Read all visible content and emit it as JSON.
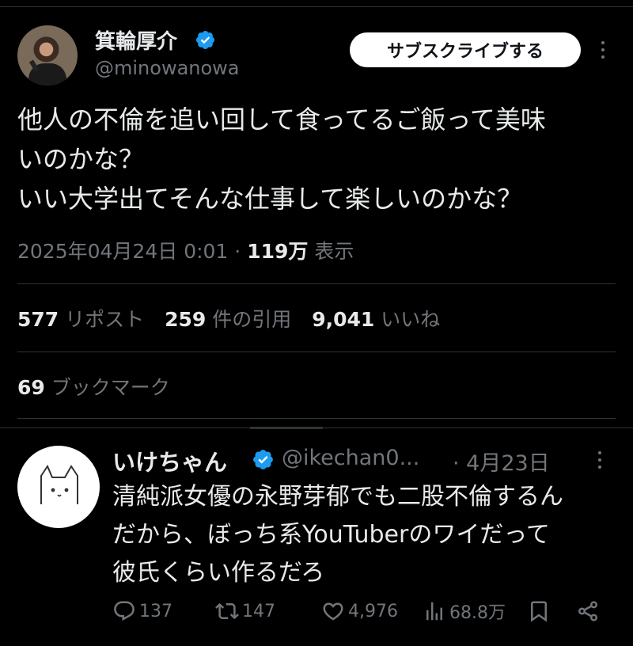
{
  "main_tweet": {
    "author_name": "箕輪厚介",
    "handle": "@minowanowa",
    "subscribe_label": "サブスクライブする",
    "text_lines": [
      "他人の不倫を追い回して食ってるご飯って美味",
      "いのかな？",
      "いい大学出てそんな仕事して楽しいのかな？"
    ],
    "timestamp": "2025年04月24日 0:01",
    "separator": "·",
    "views_count": "119万",
    "views_label": "表示",
    "stats": {
      "reposts_count": "577",
      "reposts_label": "リポスト",
      "quotes_count": "259",
      "quotes_label": "件の引用",
      "likes_count": "9,041",
      "likes_label": "いいね",
      "bookmarks_count": "69",
      "bookmarks_label": "ブックマーク"
    }
  },
  "reply": {
    "author_name": "いけちゃん",
    "handle": "@ikechan0...",
    "date": "· 4月23日",
    "text_lines": [
      "清純派女優の永野芽郁でも二股不倫するん",
      "だから、ぼっち系YouTuberのワイだって",
      "彼氏くらい作るだろ"
    ],
    "actions": {
      "replies": "137",
      "reposts": "147",
      "likes": "4,976",
      "views": "68.8万"
    }
  },
  "colors": {
    "background": "#000000",
    "text": "#e7e9ea",
    "muted": "#71767b",
    "divider": "#2f3336",
    "verified": "#1d9bf0"
  },
  "icons": [
    "verified-badge-icon",
    "more-icon",
    "reply-icon",
    "repost-icon",
    "like-icon",
    "views-icon",
    "bookmark-icon",
    "share-icon"
  ]
}
